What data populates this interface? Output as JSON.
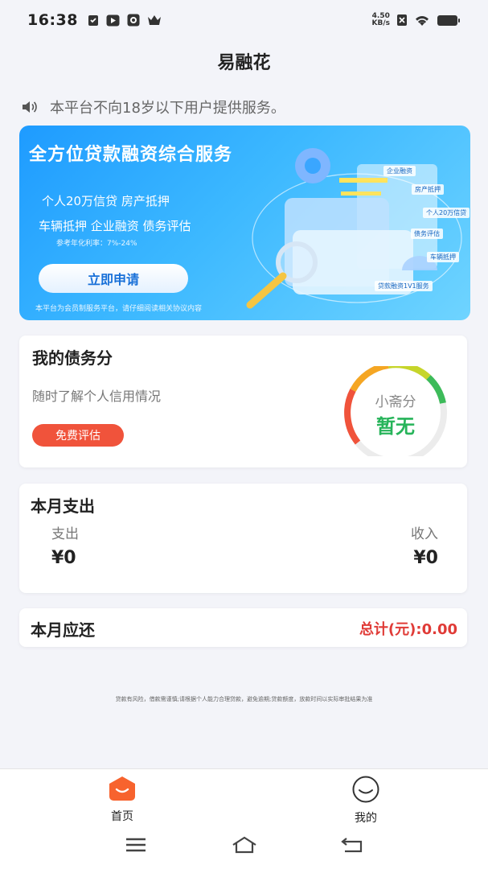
{
  "status_bar": {
    "time": "16:38",
    "speed_value": "4.50",
    "speed_unit": "KB/s",
    "left_icons": [
      "check-clipboard-icon",
      "play-icon",
      "camera-icon",
      "crown-icon"
    ],
    "right_icons": [
      "no-sim-icon",
      "wifi-icon",
      "battery-icon"
    ]
  },
  "header": {
    "title": "易融花"
  },
  "notice": {
    "icon": "speaker-icon",
    "text": "本平台不向18岁以下用户提供服务。"
  },
  "banner": {
    "title": "全方位贷款融资综合服务",
    "line1": "个人20万信贷 房产抵押",
    "line2": "车辆抵押 企业融资 债务评估",
    "rate": "参考年化利率：7%-24%",
    "button_label": "立即申请",
    "footnote": "本平台为会员制服务平台，请仔细阅读相关协议内容",
    "tags": [
      "企业融资",
      "房产抵押",
      "个人20万信贷",
      "债务评估",
      "车辆抵押",
      "贷款融资1V1服务"
    ]
  },
  "debt_card": {
    "title": "我的债务分",
    "subtitle": "随时了解个人信用情况",
    "button_label": "免费评估",
    "gauge_label": "小斋分",
    "gauge_value": "暂无"
  },
  "spend_card": {
    "title": "本月支出",
    "expense_label": "支出",
    "expense_value": "¥0",
    "income_label": "收入",
    "income_value": "¥0"
  },
  "repay_card": {
    "title": "本月应还",
    "total": "总计(元):0.00"
  },
  "disclaimer": "贷款有风险，借款需谨慎;请根据个人能力合理贷款，避免逾期;贷款额度，放款时间以实际审批结果为准",
  "tabbar": {
    "home_label": "首页",
    "mine_label": "我的"
  },
  "colors": {
    "accent_orange": "#f0533b",
    "gauge_green": "#27b45a",
    "total_red": "#e03b37",
    "banner_blue": "#1e9bff"
  }
}
